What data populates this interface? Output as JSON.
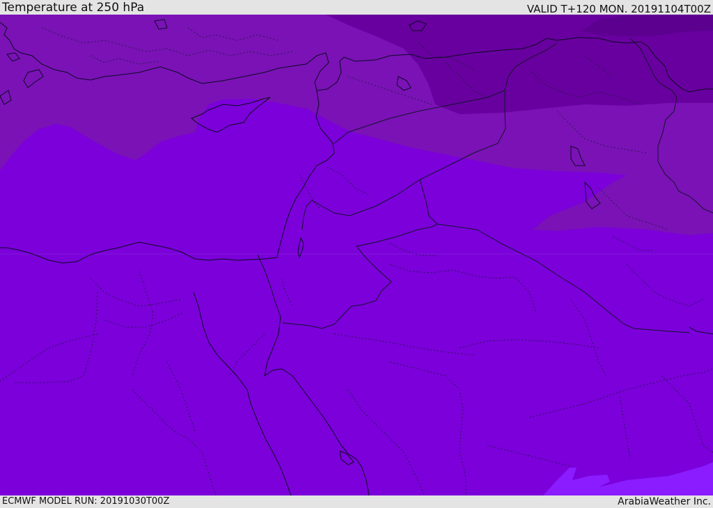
{
  "header": {
    "title": "Temperature at 250 hPa",
    "valid_time": "VALID T+120 MON. 20191104T00Z"
  },
  "footer": {
    "model_run": "ECMWF MODEL RUN: 20191030T00Z",
    "credit": "ArabiaWeather Inc."
  },
  "map": {
    "fill_colors": {
      "base": "#7b00da",
      "band_2": "#7a12b6",
      "band_3": "#68009f",
      "band_4": "#5c0090",
      "warm_patch": "#8a1cff"
    },
    "line_colors": {
      "coast": "#0b0b20",
      "border": "#14142a"
    }
  }
}
